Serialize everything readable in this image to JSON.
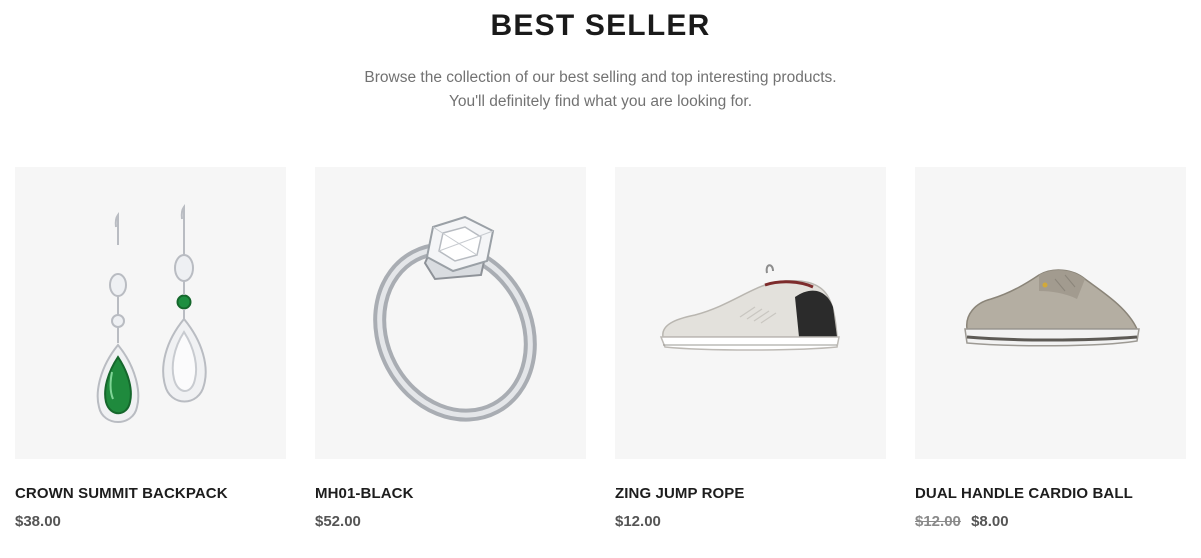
{
  "section": {
    "title": "BEST SELLER",
    "subtitle_line1": "Browse the collection of our best selling and top interesting products.",
    "subtitle_line2": "You'll definitely find what you are looking for."
  },
  "products": [
    {
      "name": "CROWN SUMMIT BACKPACK",
      "price": "$38.00",
      "image_icon": "emerald-earrings-image"
    },
    {
      "name": "MH01-BLACK",
      "price": "$52.00",
      "image_icon": "diamond-ring-image"
    },
    {
      "name": "ZING JUMP ROPE",
      "price": "$12.00",
      "image_icon": "white-sneaker-image"
    },
    {
      "name": "DUAL HANDLE CARDIO BALL",
      "old_price": "$12.00",
      "price": "$8.00",
      "image_icon": "grey-sneaker-image"
    }
  ]
}
